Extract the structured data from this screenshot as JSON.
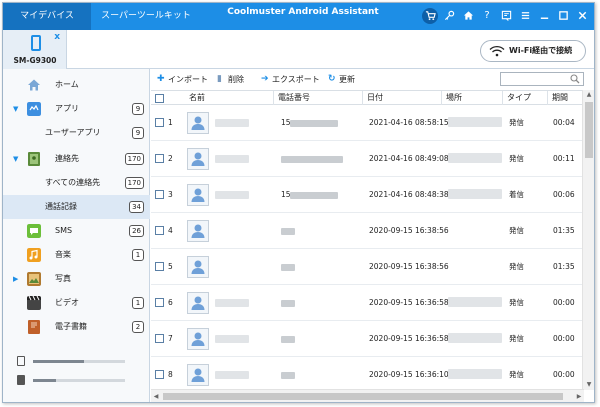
{
  "titlebar": {
    "tabs": [
      "マイデバイス",
      "スーパーツールキット"
    ],
    "title": "Coolmuster Android Assistant",
    "icons": [
      "cart-icon",
      "key-icon",
      "home-icon",
      "help-icon",
      "feedback-icon",
      "menu-icon",
      "minimize-icon",
      "maximize-icon",
      "close-icon"
    ],
    "help_glyph": "?",
    "accent": "#1d8ee6"
  },
  "device": {
    "name": "SM-G9300",
    "close_glyph": "x"
  },
  "wifi_button": {
    "label": "Wi-Fi経由で接続"
  },
  "sidebar": {
    "items": [
      {
        "label": "ホーム",
        "icon": "home-icon",
        "color": "#7aa7d6"
      },
      {
        "label": "アプリ",
        "icon": "apps-icon",
        "badge": "9",
        "arrow": "▼",
        "color": "#3d8fe0"
      },
      {
        "label": "ユーザーアプリ",
        "badge": "9",
        "sub": true
      },
      {
        "label": "連絡先",
        "icon": "contacts-icon",
        "badge": "170",
        "arrow": "▼",
        "color": "#5a8a3a"
      },
      {
        "label": "すべての連絡先",
        "badge": "170",
        "sub": true
      },
      {
        "label": "通話記録",
        "badge": "34",
        "sub": true,
        "selected": true
      },
      {
        "label": "SMS",
        "icon": "sms-icon",
        "badge": "26",
        "color": "#6cbf3a"
      },
      {
        "label": "音楽",
        "icon": "music-icon",
        "badge": "1",
        "color": "#f0a020"
      },
      {
        "label": "写真",
        "icon": "photos-icon",
        "arrow": "▶",
        "color": "#b07a30"
      },
      {
        "label": "ビデオ",
        "icon": "video-icon",
        "badge": "1",
        "color": "#444444"
      },
      {
        "label": "電子書籍",
        "icon": "ebook-icon",
        "badge": "2",
        "color": "#c0602a"
      }
    ],
    "storage": [
      {
        "icon": "phone-storage-icon",
        "used": 0.55
      },
      {
        "icon": "sdcard-icon",
        "used": 0.25
      }
    ]
  },
  "toolbar": {
    "import": "インポート",
    "delete": "削除",
    "export": "エクスポート",
    "refresh": "更新",
    "search_placeholder": "",
    "import_glyph": "✚",
    "delete_glyph": "▮",
    "export_glyph": "➔",
    "refresh_glyph": "↻"
  },
  "table": {
    "columns": [
      "名前",
      "電話番号",
      "日付",
      "場所",
      "タイプ",
      "期間"
    ],
    "rows": [
      {
        "num": "1",
        "phone": "15",
        "date": "2021-04-16 08:58:15",
        "type": "発信",
        "duration": "00:04"
      },
      {
        "num": "2",
        "phone": "",
        "date": "2021-04-16 08:49:08",
        "type": "発信",
        "duration": "00:11"
      },
      {
        "num": "3",
        "phone": "15",
        "date": "2021-04-16 08:48:38",
        "type": "着信",
        "duration": "00:06"
      },
      {
        "num": "4",
        "phone": "",
        "date": "2020-09-15 16:38:56",
        "type": "発信",
        "duration": "01:35"
      },
      {
        "num": "5",
        "phone": "",
        "date": "2020-09-15 16:38:56",
        "type": "発信",
        "duration": "01:35"
      },
      {
        "num": "6",
        "phone": "",
        "date": "2020-09-15 16:36:58",
        "type": "発信",
        "duration": "00:00"
      },
      {
        "num": "7",
        "phone": "",
        "date": "2020-09-15 16:36:58",
        "type": "発信",
        "duration": "00:00"
      },
      {
        "num": "8",
        "phone": "",
        "date": "2020-09-15 16:36:10",
        "type": "発信",
        "duration": "00:00"
      }
    ]
  }
}
